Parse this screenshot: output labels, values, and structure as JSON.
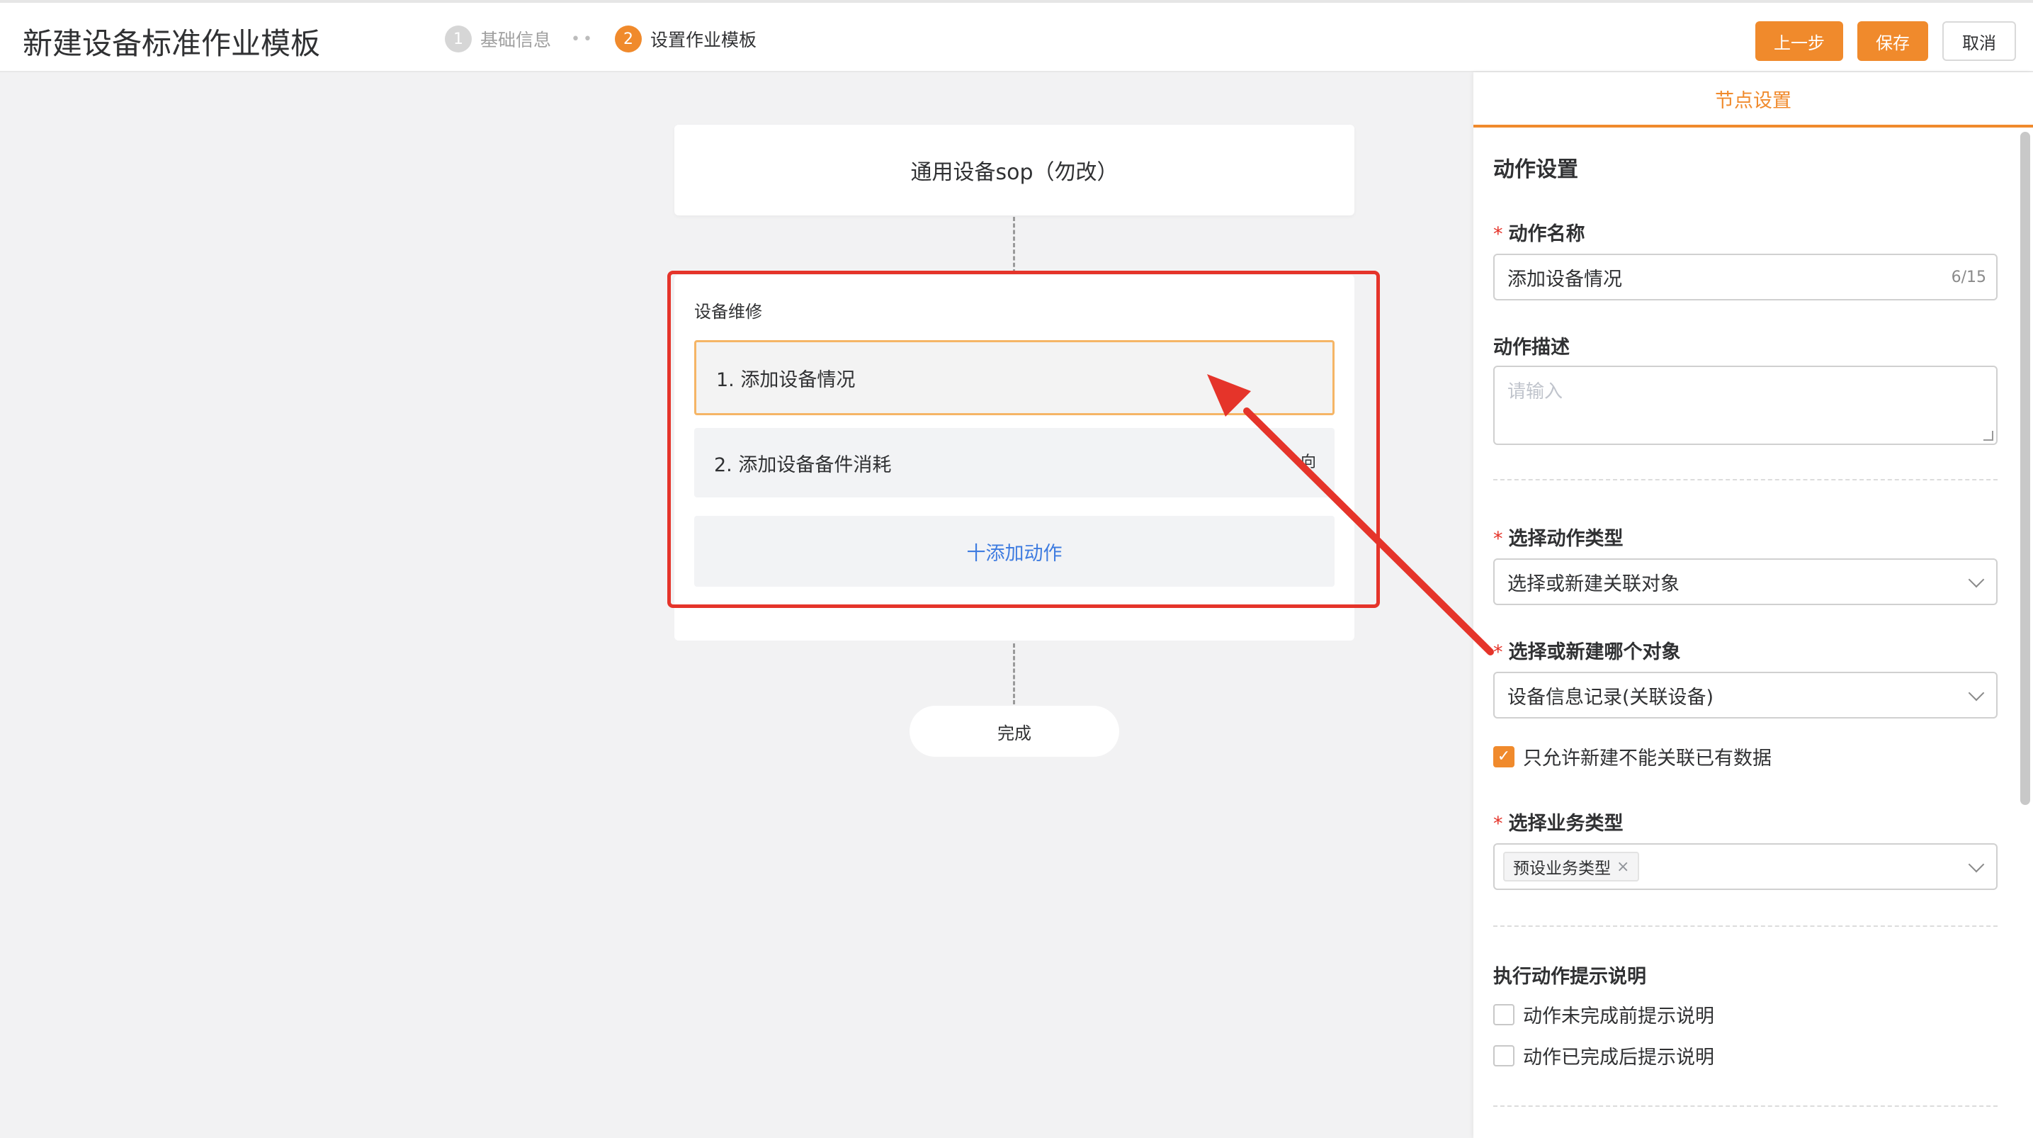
{
  "header": {
    "title": "新建设备标准作业模板",
    "steps": [
      {
        "num": "1",
        "label": "基础信息"
      },
      {
        "num": "2",
        "label": "设置作业模板"
      }
    ],
    "buttons": {
      "prev": "上一步",
      "save": "保存",
      "cancel": "取消"
    }
  },
  "flow": {
    "template_name": "通用设备sop（勿改）",
    "node": {
      "name": "设备维修",
      "actions": [
        {
          "label": "1. 添加设备情况"
        },
        {
          "label": "2. 添加设备备件消耗",
          "trail": "向"
        }
      ],
      "add_action": "十添加动作"
    },
    "finish": "完成"
  },
  "panel": {
    "tab": "节点设置",
    "section_title": "动作设置",
    "action_name": {
      "label": "动作名称",
      "value": "添加设备情况",
      "count": "6/15"
    },
    "action_desc": {
      "label": "动作描述",
      "placeholder": "请输入"
    },
    "action_type": {
      "label": "选择动作类型",
      "value": "选择或新建关联对象"
    },
    "target_object": {
      "label": "选择或新建哪个对象",
      "value": "设备信息记录(关联设备)"
    },
    "only_new": {
      "label": "只允许新建不能关联已有数据",
      "checked": true
    },
    "biz_type": {
      "label": "选择业务类型",
      "tag": "预设业务类型",
      "tag_close": "×"
    },
    "hint_section": {
      "title": "执行动作提示说明",
      "before": "动作未完成前提示说明",
      "after": "动作已完成后提示说明"
    }
  },
  "colors": {
    "accent": "#f08a2c",
    "highlight": "#e5342a",
    "link": "#3f7ce0"
  }
}
